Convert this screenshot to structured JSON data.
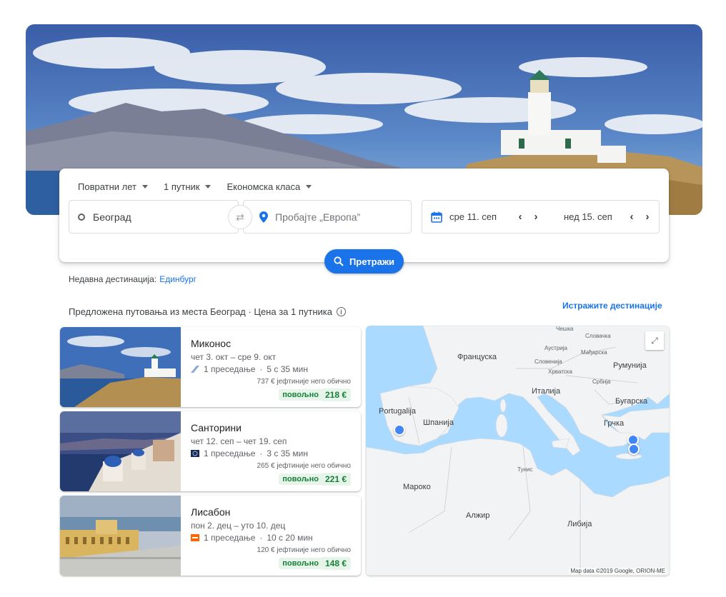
{
  "search": {
    "trip_type": "Повратни лет",
    "passengers": "1 путник",
    "cabin_class": "Економска класа",
    "origin": "Београд",
    "destination_placeholder": "Пробајте „Европа”",
    "depart_date": "сре 11. сеп",
    "return_date": "нед 15. сеп",
    "search_button": "Претражи"
  },
  "recent": {
    "label": "Недавна дестинација:",
    "link": "Единбург"
  },
  "suggest": {
    "heading": "Предложена путовања из места Београд · Цена за 1 путника",
    "explore_link": "Истражите дестинације"
  },
  "trips": [
    {
      "destination": "Миконос",
      "dates": "чет 3. окт – сре 9. окт",
      "stops": "1 преседање",
      "duration": "5 с 35 мин",
      "cheaper": "737 € јефтиније него обично",
      "badge": "повољно",
      "price": "218 €",
      "airline_icon": "airline-aegean-icon"
    },
    {
      "destination": "Санторини",
      "dates": "чет 12. сеп – чет 19. сеп",
      "stops": "1 преседање",
      "duration": "3 с 35 мин",
      "cheaper": "265 € јефтиније него обично",
      "badge": "повољно",
      "price": "221 €",
      "airline_icon": "airline-airserbia-icon"
    },
    {
      "destination": "Лисабон",
      "dates": "пон 2. дец – уто 10. дец",
      "stops": "1 преседање",
      "duration": "10 с 20 мин",
      "cheaper": "120 € јефтиније него обично",
      "badge": "повољно",
      "price": "148 €",
      "airline_icon": "airline-easyjet-icon"
    }
  ],
  "map": {
    "labels": {
      "czech": "Чешка",
      "slovakia": "Словачка",
      "austria": "Аустрија",
      "hungary": "Мађарска",
      "france": "Француска",
      "slovenia": "Словенија",
      "croatia": "Хрватска",
      "romania": "Румунија",
      "serbia": "Србија",
      "italy": "Италија",
      "bulgaria": "Бугарска",
      "portugal": "Portugalija",
      "spain": "Шпанија",
      "greece": "Грчка",
      "tunisia": "Тунис",
      "morocco": "Мароко",
      "algeria": "Алжир",
      "libya": "Либија"
    },
    "attribution": "Map data ©2019 Google, ORION-ME"
  },
  "colors": {
    "accent": "#1a73e8",
    "good_price": "#188038",
    "good_bg": "#e6f4ea",
    "sea": "#aadaff",
    "land": "#f1f3f4"
  }
}
